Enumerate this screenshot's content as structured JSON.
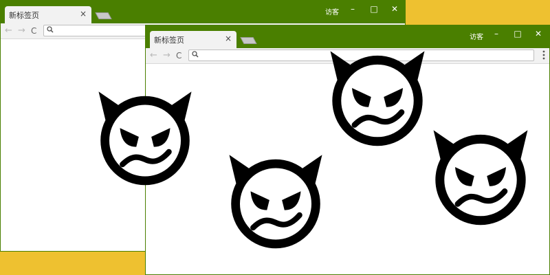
{
  "windows": {
    "back": {
      "tab": {
        "title": "新标签页",
        "close": "×"
      },
      "user_label": "访客",
      "controls": {
        "minimize": "–",
        "maximize": "□",
        "close": "✕"
      },
      "nav": {
        "back": "←",
        "forward": "→",
        "reload": "C"
      }
    },
    "front": {
      "tab": {
        "title": "新标签页",
        "close": "×"
      },
      "user_label": "访客",
      "controls": {
        "minimize": "–",
        "maximize": "□",
        "close": "✕"
      },
      "nav": {
        "back": "←",
        "forward": "→",
        "reload": "C"
      }
    }
  },
  "colors": {
    "desktop": "#eec130",
    "titlebar": "#4a7f00",
    "tab": "#f2f2f2",
    "toolbar": "#f2f2f2",
    "content": "#ffffff",
    "emoji": "#000000"
  },
  "icons": [
    "search-icon",
    "menu-icon",
    "back-arrow-icon",
    "forward-arrow-icon",
    "reload-icon",
    "devil-face-icon"
  ]
}
